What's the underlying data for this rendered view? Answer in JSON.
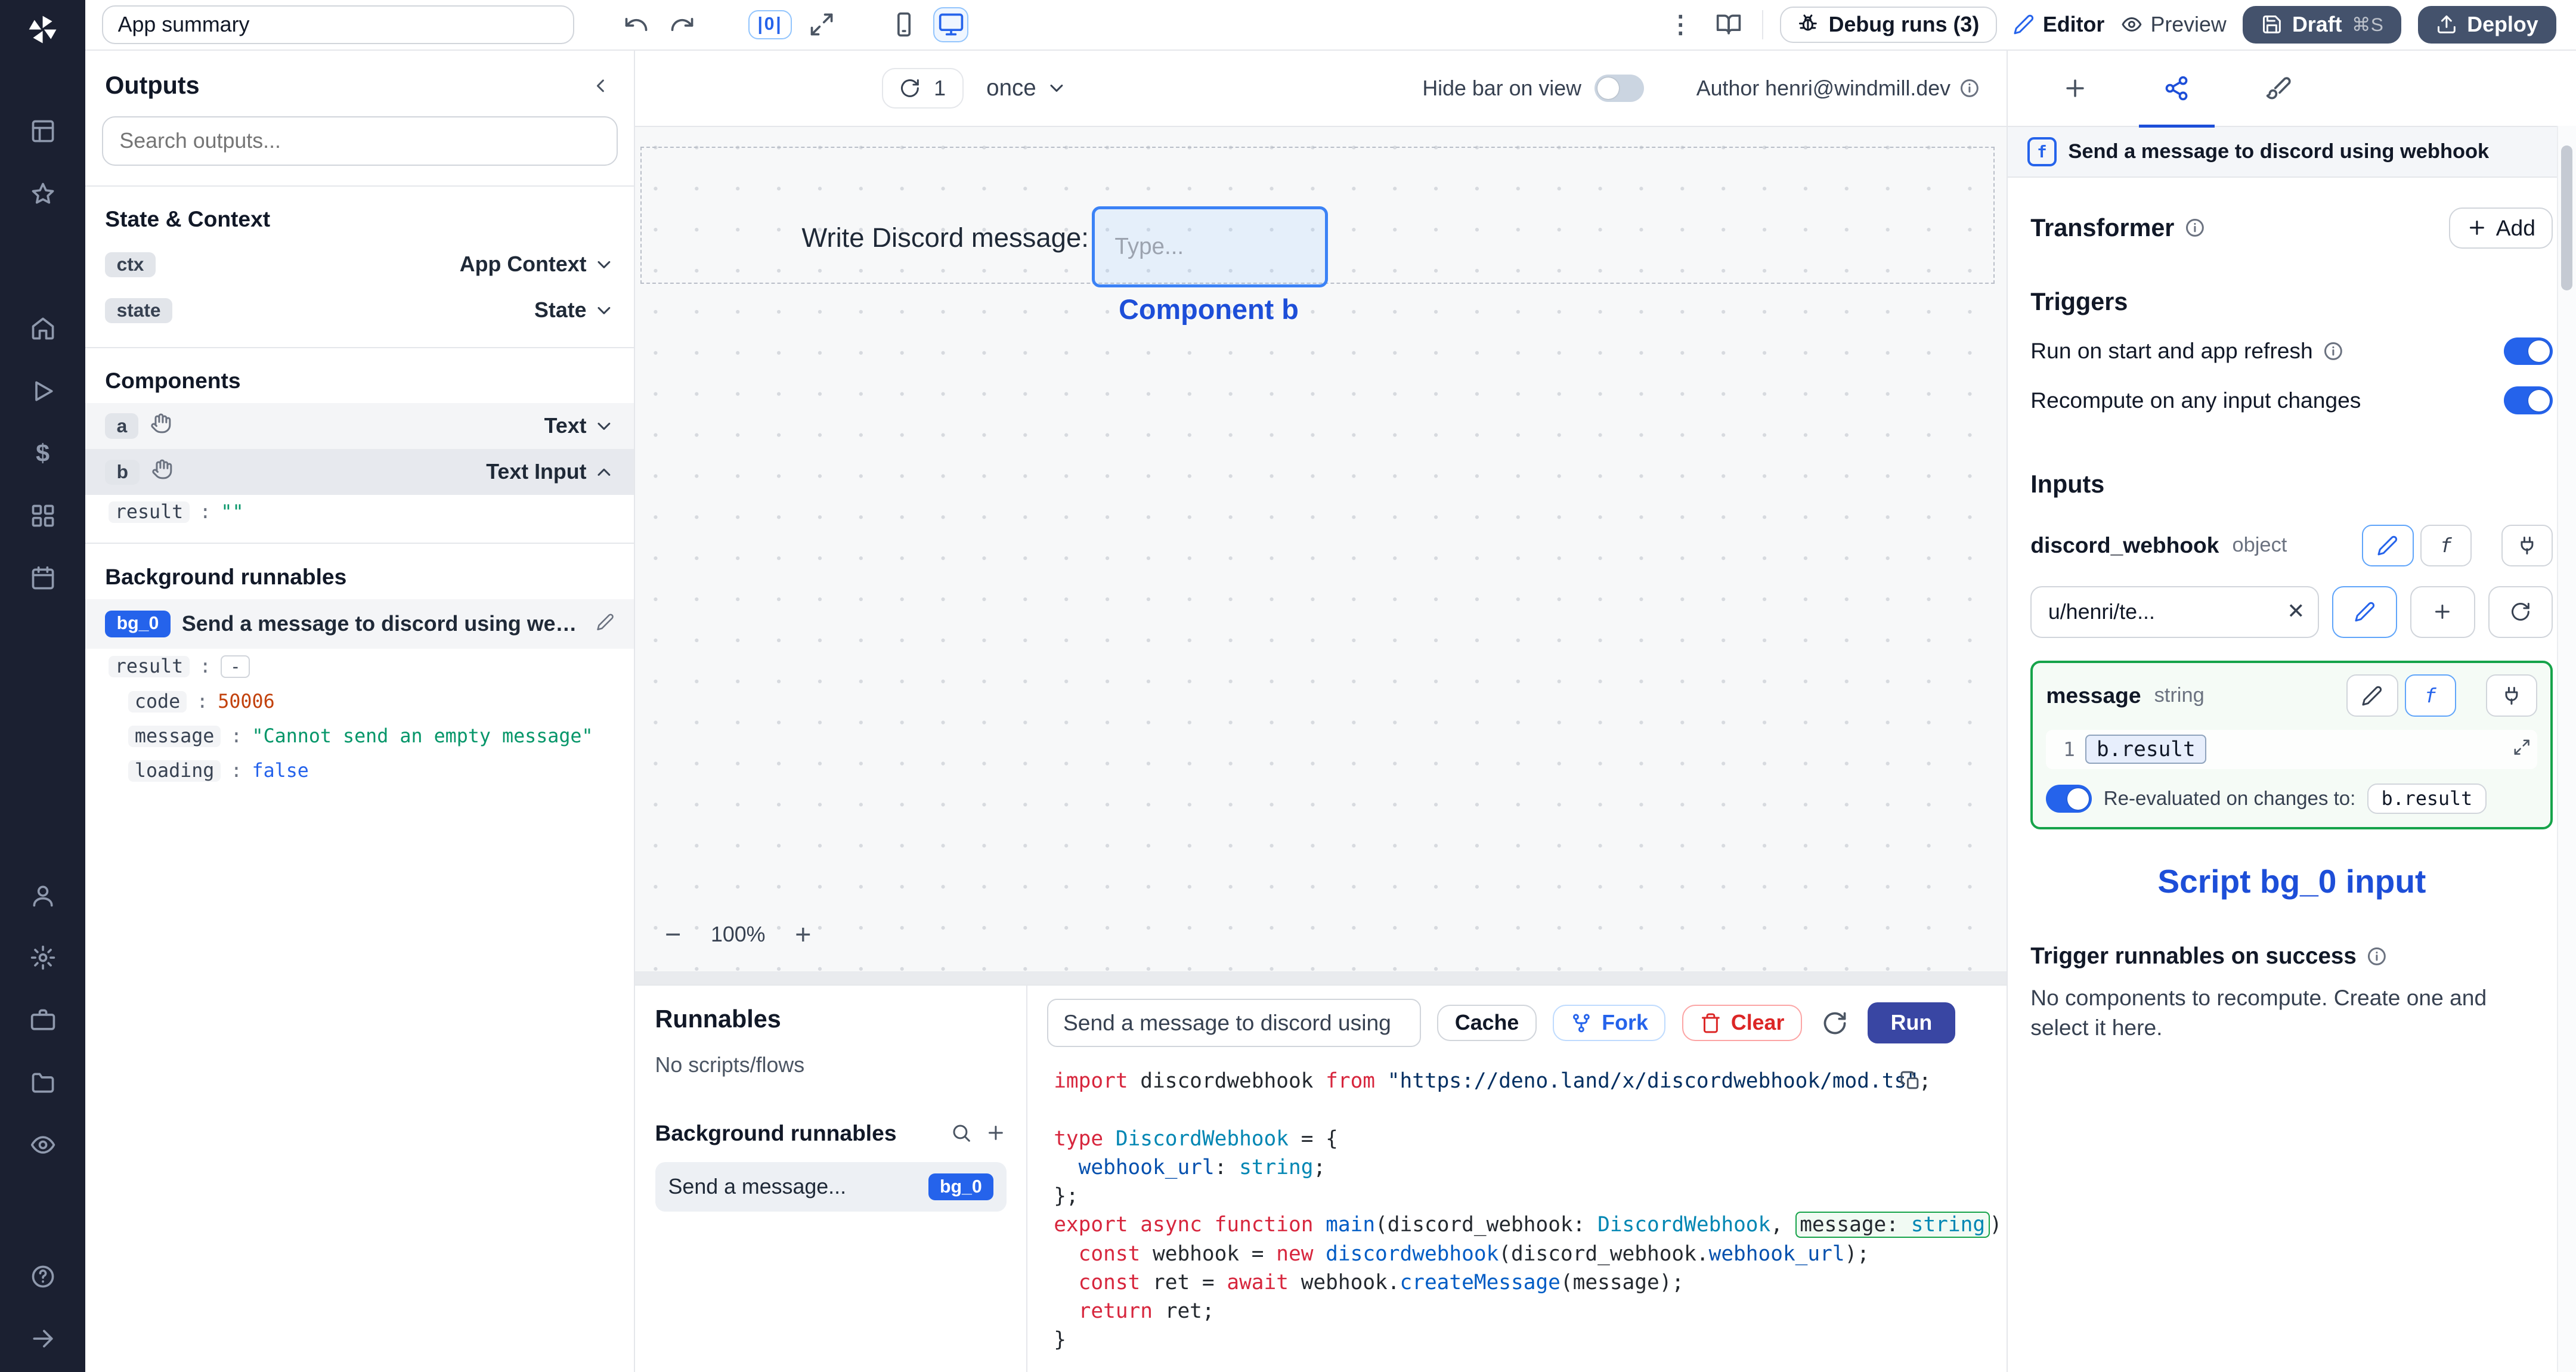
{
  "icons": {
    "kebab": "⋮",
    "dollar": "$",
    "fn": "f",
    "close": "✕",
    "plus": "+",
    "minus": "−",
    "align": "|0|",
    "question": "?"
  },
  "punct": {
    "colon": ":"
  },
  "colors": {
    "accent": "#2563eb",
    "annotation_blue": "#1d4ed8",
    "green_border": "#16a34a",
    "dark_button": "#44526c",
    "run_button": "#3946a3"
  },
  "toolbar": {
    "app_summary": "App summary",
    "debug_runs": "Debug runs (3)",
    "editor": "Editor",
    "preview": "Preview",
    "draft": "Draft",
    "draft_shortcut": "⌘S",
    "deploy": "Deploy"
  },
  "outputs": {
    "title": "Outputs",
    "search_placeholder": "Search outputs...",
    "state_context": "State & Context",
    "ctx": {
      "badge": "ctx",
      "label": "App Context"
    },
    "state": {
      "badge": "state",
      "label": "State"
    },
    "components": "Components",
    "comp_a": {
      "badge": "a",
      "label": "Text"
    },
    "comp_b": {
      "badge": "b",
      "label": "Text Input"
    },
    "b_result": {
      "key": "result",
      "value": "\"\""
    },
    "background": "Background runnables",
    "bg0": {
      "badge": "bg_0",
      "label": "Send a message to discord using webhook"
    },
    "bg0_result": {
      "key": "result",
      "value": "-"
    },
    "bg0_fields": [
      {
        "key": "code",
        "value": "50006"
      },
      {
        "key": "message",
        "value": "\"Cannot send an empty message\""
      },
      {
        "key": "loading",
        "value": "false"
      }
    ]
  },
  "canvas": {
    "run_count": "1",
    "mode": "once",
    "hide_bar": "Hide bar on view",
    "author": "Author henri@windmill.dev",
    "component_label": "Write Discord message:",
    "input_placeholder": "Type...",
    "annotation": "Component b",
    "zoom": "100%"
  },
  "runnables": {
    "title": "Runnables",
    "empty": "No scripts/flows",
    "background": "Background runnables",
    "item": {
      "label": "Send a message...",
      "badge": "bg_0"
    }
  },
  "runner": {
    "name": "Send a message to discord using",
    "cache": "Cache",
    "fork": "Fork",
    "clear": "Clear",
    "run": "Run"
  },
  "code": {
    "lines": [
      [
        {
          "c": "k",
          "t": "import"
        },
        {
          "c": "p",
          "t": " discordwebhook "
        },
        {
          "c": "k",
          "t": "from"
        },
        {
          "c": "p",
          "t": " "
        },
        {
          "c": "s",
          "t": "\"https://deno.land/x/discordwebhook/mod.ts\""
        },
        {
          "c": "p",
          "t": ";"
        }
      ],
      [],
      [
        {
          "c": "k",
          "t": "type"
        },
        {
          "c": "p",
          "t": " "
        },
        {
          "c": "t",
          "t": "DiscordWebhook"
        },
        {
          "c": "p",
          "t": " = {"
        }
      ],
      [
        {
          "c": "p",
          "t": "  "
        },
        {
          "c": "pr",
          "t": "webhook_url"
        },
        {
          "c": "p",
          "t": ": "
        },
        {
          "c": "t",
          "t": "string"
        },
        {
          "c": "p",
          "t": ";"
        }
      ],
      [
        {
          "c": "p",
          "t": "};"
        }
      ],
      [
        {
          "c": "k",
          "t": "export"
        },
        {
          "c": "p",
          "t": " "
        },
        {
          "c": "k",
          "t": "async"
        },
        {
          "c": "p",
          "t": " "
        },
        {
          "c": "k",
          "t": "function"
        },
        {
          "c": "p",
          "t": " "
        },
        {
          "c": "f",
          "t": "main"
        },
        {
          "c": "p",
          "t": "(discord_webhook: "
        },
        {
          "c": "t",
          "t": "DiscordWebhook"
        },
        {
          "c": "p",
          "t": ", "
        },
        {
          "c": "p",
          "t": "message: ",
          "b": "s"
        },
        {
          "c": "t",
          "t": "string",
          "b": "e"
        },
        {
          "c": "p",
          "t": ") {"
        }
      ],
      [
        {
          "c": "p",
          "t": "  "
        },
        {
          "c": "k",
          "t": "const"
        },
        {
          "c": "p",
          "t": " webhook = "
        },
        {
          "c": "k",
          "t": "new"
        },
        {
          "c": "p",
          "t": " "
        },
        {
          "c": "f",
          "t": "discordwebhook"
        },
        {
          "c": "p",
          "t": "(discord_webhook."
        },
        {
          "c": "pr",
          "t": "webhook_url"
        },
        {
          "c": "p",
          "t": ");"
        }
      ],
      [
        {
          "c": "p",
          "t": "  "
        },
        {
          "c": "k",
          "t": "const"
        },
        {
          "c": "p",
          "t": " ret = "
        },
        {
          "c": "k",
          "t": "await"
        },
        {
          "c": "p",
          "t": " webhook."
        },
        {
          "c": "f",
          "t": "createMessage"
        },
        {
          "c": "p",
          "t": "(message);"
        }
      ],
      [
        {
          "c": "p",
          "t": "  "
        },
        {
          "c": "k",
          "t": "return"
        },
        {
          "c": "p",
          "t": " ret;"
        }
      ],
      [
        {
          "c": "p",
          "t": "}"
        }
      ]
    ]
  },
  "settings": {
    "header": "Send a message to discord using webhook",
    "transformer": "Transformer",
    "add": "Add",
    "triggers": "Triggers",
    "run_on_start": "Run on start and app refresh",
    "recompute": "Recompute on any input changes",
    "inputs": "Inputs",
    "discord_webhook": {
      "name": "discord_webhook",
      "type": "object",
      "value": "u/henri/te..."
    },
    "message": {
      "name": "message",
      "type": "string",
      "line_no": "1",
      "expr": "b.result"
    },
    "reeval": {
      "label": "Re-evaluated on changes to:",
      "badge": "b.result"
    },
    "annotation": "Script bg_0 input",
    "on_success": "Trigger runnables on success",
    "on_success_desc": "No components to recompute. Create one and select it here."
  }
}
